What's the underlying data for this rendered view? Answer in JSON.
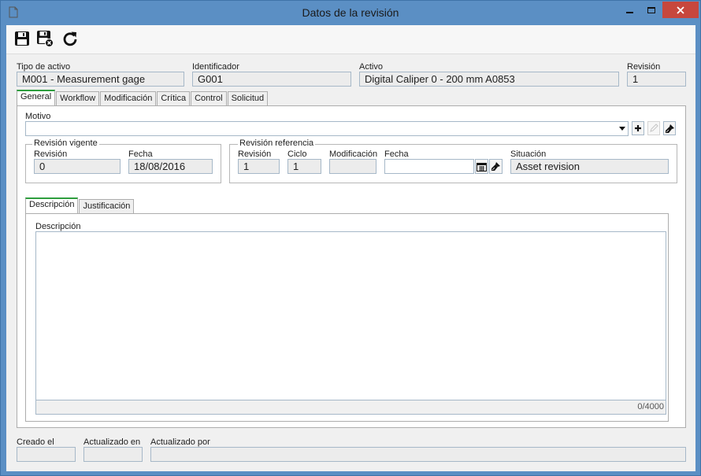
{
  "window": {
    "title": "Datos de la revisión"
  },
  "header": {
    "asset_type": {
      "label": "Tipo de activo",
      "value": "M001 - Measurement gage"
    },
    "identifier": {
      "label": "Identificador",
      "value": "G001"
    },
    "asset": {
      "label": "Activo",
      "value": "Digital Caliper 0 - 200 mm A0853"
    },
    "revision": {
      "label": "Revisión",
      "value": "1"
    }
  },
  "tabs": [
    "General",
    "Workflow",
    "Modificación",
    "Crítica",
    "Control",
    "Solicitud"
  ],
  "general": {
    "motivo_label": "Motivo",
    "motivo_value": "",
    "current_revision": {
      "title": "Revisión vigente",
      "revision_label": "Revisión",
      "revision_value": "0",
      "date_label": "Fecha",
      "date_value": "18/08/2016"
    },
    "reference_revision": {
      "title": "Revisión referencia",
      "revision_label": "Revisión",
      "revision_value": "1",
      "cycle_label": "Ciclo",
      "cycle_value": "1",
      "modification_label": "Modificación",
      "modification_value": "",
      "date_label": "Fecha",
      "date_value": "",
      "status_label": "Situación",
      "status_value": "Asset revision"
    },
    "subtabs": [
      "Descripción",
      "Justificación"
    ],
    "description_label": "Descripción",
    "description_value": "",
    "description_counter": "0/4000"
  },
  "footer": {
    "created_label": "Creado el",
    "created_value": "",
    "updated_on_label": "Actualizado en",
    "updated_on_value": "",
    "updated_by_label": "Actualizado por",
    "updated_by_value": ""
  },
  "icons": {
    "save": "save-icon",
    "save_close": "save-close-icon",
    "refresh": "refresh-icon",
    "add": "plus-icon",
    "edit": "pencil-icon",
    "clear": "eraser-icon",
    "calendar": "calendar-icon"
  }
}
